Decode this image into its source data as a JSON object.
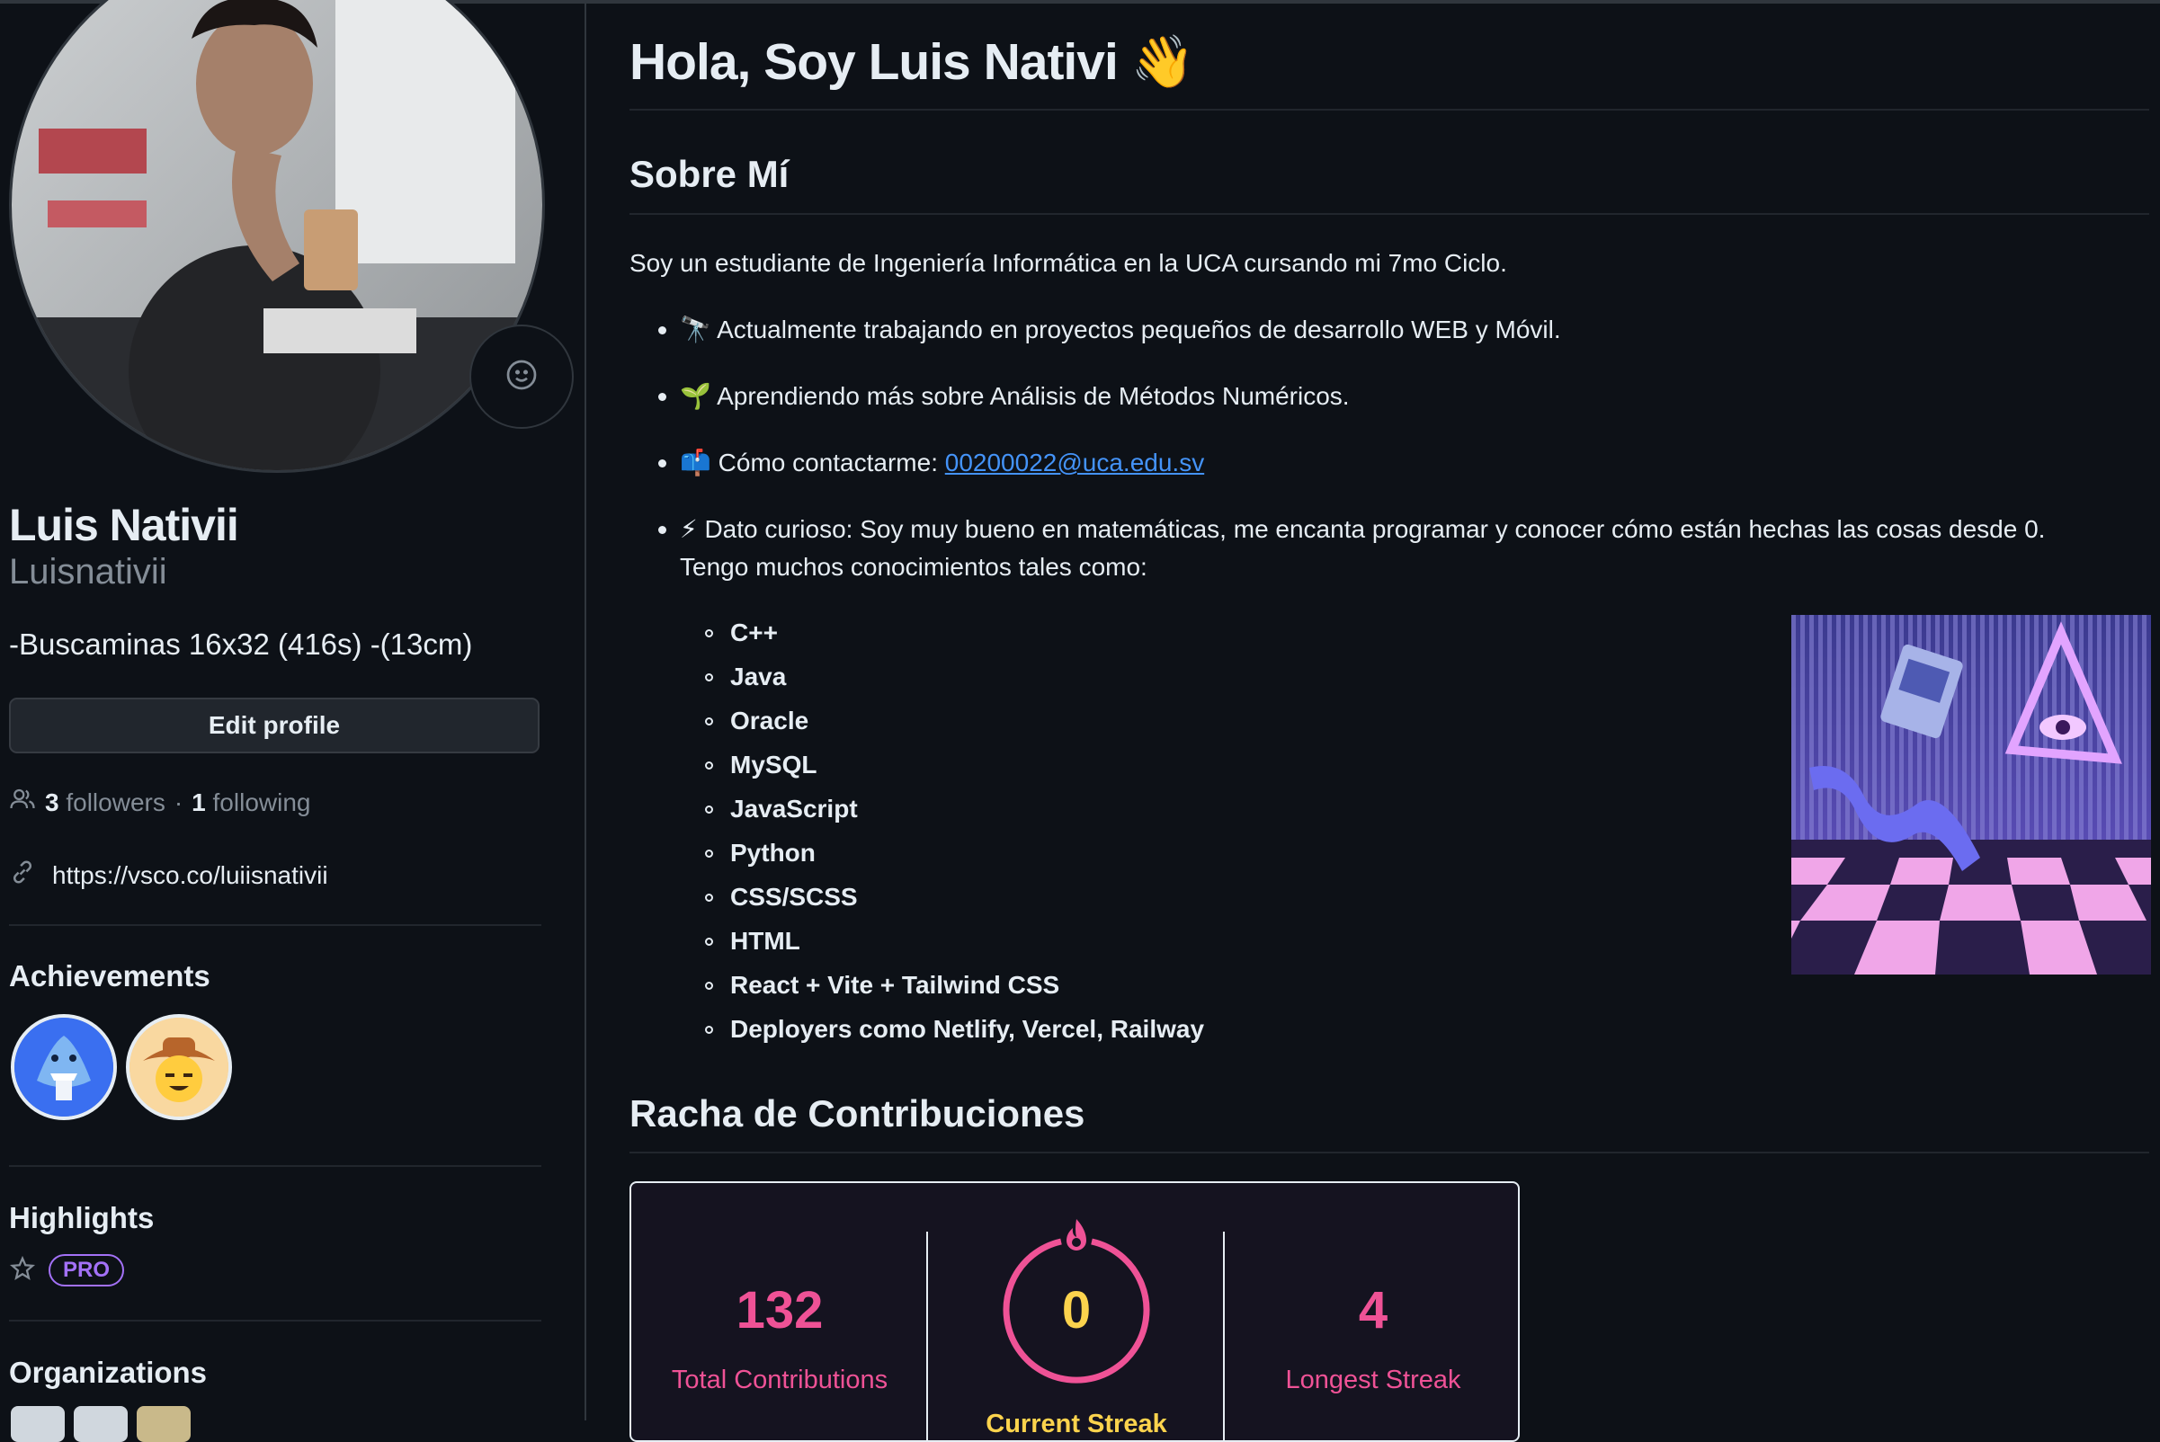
{
  "profile": {
    "name": "Luis Nativii",
    "login": "Luisnativii",
    "bio": "-Buscaminas 16x32 (416s) -(13cm)",
    "edit_label": "Edit profile",
    "followers_count": "3",
    "followers_label": "followers",
    "following_count": "1",
    "following_label": "following",
    "website": "https://vsco.co/luiisnativii"
  },
  "sidebar": {
    "achievements_title": "Achievements",
    "highlights_title": "Highlights",
    "pro_label": "PRO",
    "organizations_title": "Organizations"
  },
  "readme": {
    "title": "Hola, Soy Luis Nativi 👋",
    "about_title": "Sobre Mí",
    "intro": "Soy un estudiante de Ingeniería Informática en la UCA cursando mi 7mo Ciclo.",
    "bullets": [
      {
        "emoji": "🔭",
        "text": "Actualmente trabajando en proyectos pequeños de desarrollo WEB y Móvil."
      },
      {
        "emoji": "🌱",
        "text": "Aprendiendo más sobre Análisis de Métodos Numéricos."
      },
      {
        "emoji": "📫",
        "text": "Cómo contactarme:",
        "link": "00200022@uca.edu.sv"
      },
      {
        "emoji": "⚡",
        "text": "Dato curioso: Soy muy bueno en matemáticas, me encanta programar y conocer cómo están hechas las cosas desde 0.",
        "text2": "Tengo muchos conocimientos tales como:"
      }
    ],
    "skills": [
      "C++",
      "Java",
      "Oracle",
      "MySQL",
      "JavaScript",
      "Python",
      "CSS/SCSS",
      "HTML",
      "React + Vite + Tailwind CSS",
      "Deployers como Netlify, Vercel, Railway"
    ],
    "streak_title": "Racha de Contribuciones"
  },
  "streak": {
    "total_value": "132",
    "total_label": "Total Contributions",
    "current_value": "0",
    "current_label": "Current Streak",
    "longest_value": "4",
    "longest_label": "Longest Streak"
  },
  "colors": {
    "background": "#0d1117",
    "text": "#e6edf3",
    "muted": "#848d97",
    "link": "#4493f8",
    "streak_pink": "#ef5296",
    "streak_yellow": "#fcd34d",
    "pro_purple": "#a371f7"
  },
  "icons": [
    "smiley-icon",
    "people-icon",
    "link-icon",
    "star-icon",
    "flame-icon"
  ]
}
